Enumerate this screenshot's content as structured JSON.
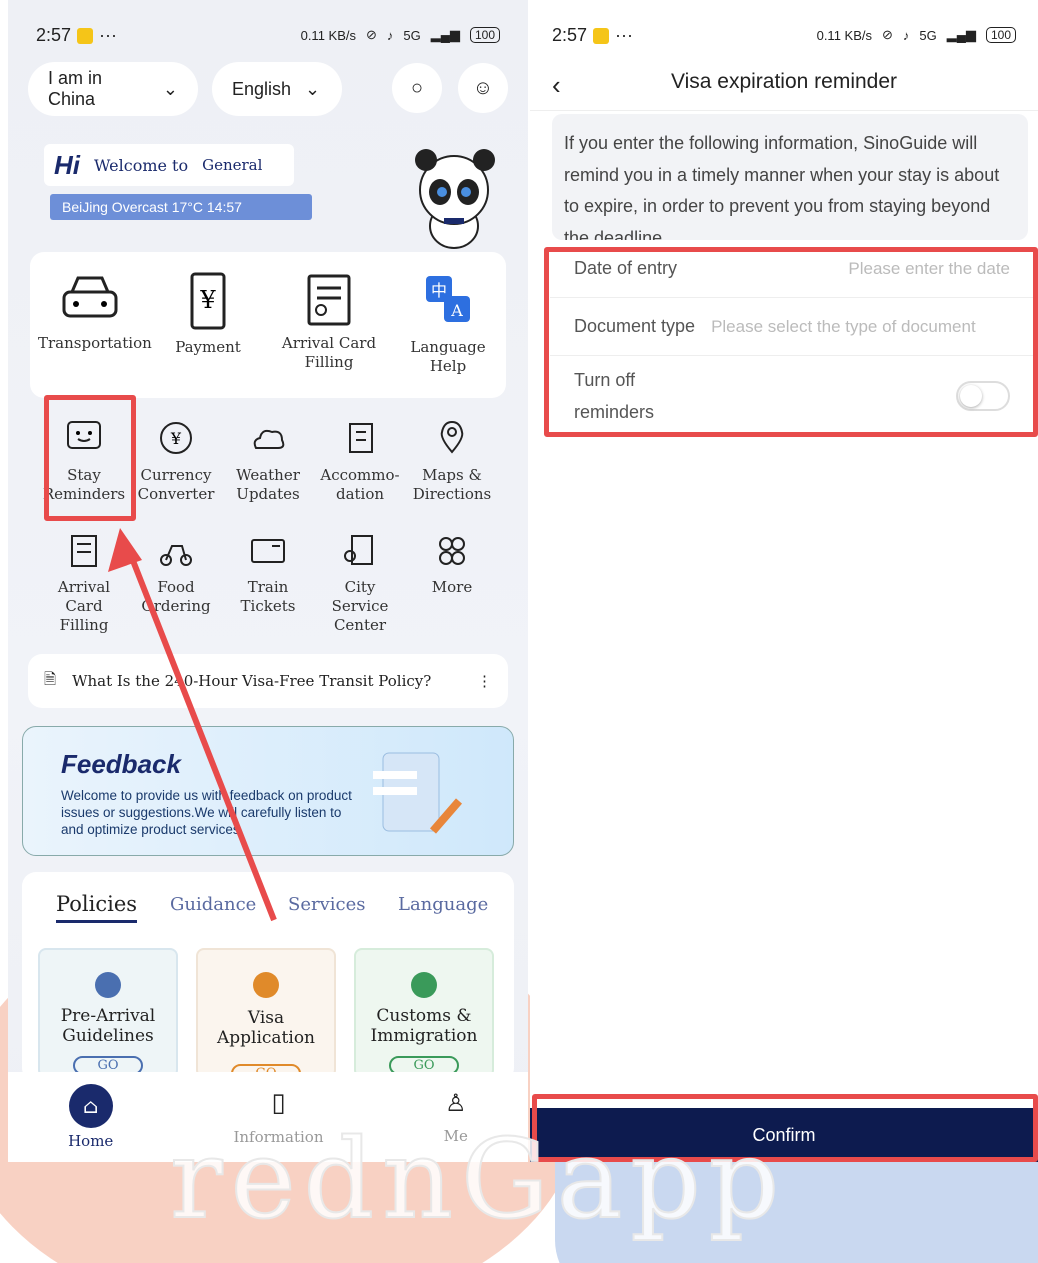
{
  "left": {
    "status": {
      "time": "2:57",
      "dots": "···",
      "speed": "0.11 KB/s",
      "net": "5G",
      "battery": "100"
    },
    "location_select": "I am in China",
    "language_select": "English",
    "hi": "Hi",
    "welcome": "Welcome to",
    "general": "General",
    "weather": "BeiJing Overcast 17°C   14:57",
    "top_grid": [
      "Transportation",
      "Payment",
      "Arrival Card Filling",
      "Language Help"
    ],
    "grid_row1": [
      "Stay Reminders",
      "Currency Converter",
      "Weather Updates",
      "Accommo- dation",
      "Maps & Directions"
    ],
    "grid_row2": [
      "Arrival Card Filling",
      "Food Ordering",
      "Train Tickets",
      "City Service Center",
      "More"
    ],
    "notice": "What Is the 240-Hour Visa-Free Transit Policy?",
    "feedback": {
      "title": "Feedback",
      "text": "Welcome to provide us with feedback on product issues or suggestions.We will carefully listen to and optimize product services."
    },
    "tabs": [
      "Policies",
      "Guidance",
      "Services",
      "Language"
    ],
    "tiles": [
      {
        "label": "Pre-Arrival Guidelines",
        "go": "GO"
      },
      {
        "label": "Visa Application",
        "go": "GO"
      },
      {
        "label": "Customs & Immigration",
        "go": "GO"
      }
    ],
    "nav": [
      "Home",
      "Information",
      "Me"
    ]
  },
  "right": {
    "status": {
      "time": "2:57",
      "dots": "···",
      "speed": "0.11 KB/s",
      "net": "5G",
      "battery": "100"
    },
    "title": "Visa expiration reminder",
    "info": "If you enter the following information, SinoGuide will remind you in a timely manner when your stay is about to expire, in order to prevent you from staying beyond the deadline.",
    "fields": {
      "date_label": "Date of entry",
      "date_ph": "Please enter the date",
      "doc_label": "Document type",
      "doc_ph": "Please select the type of document",
      "toggle_label": "Turn off reminders"
    },
    "confirm": "Confirm"
  },
  "watermark": "rednGapp",
  "colors": {
    "accent": "#1a2a6c",
    "highlight": "#e84b4b",
    "confirm": "#0d1b4f"
  }
}
